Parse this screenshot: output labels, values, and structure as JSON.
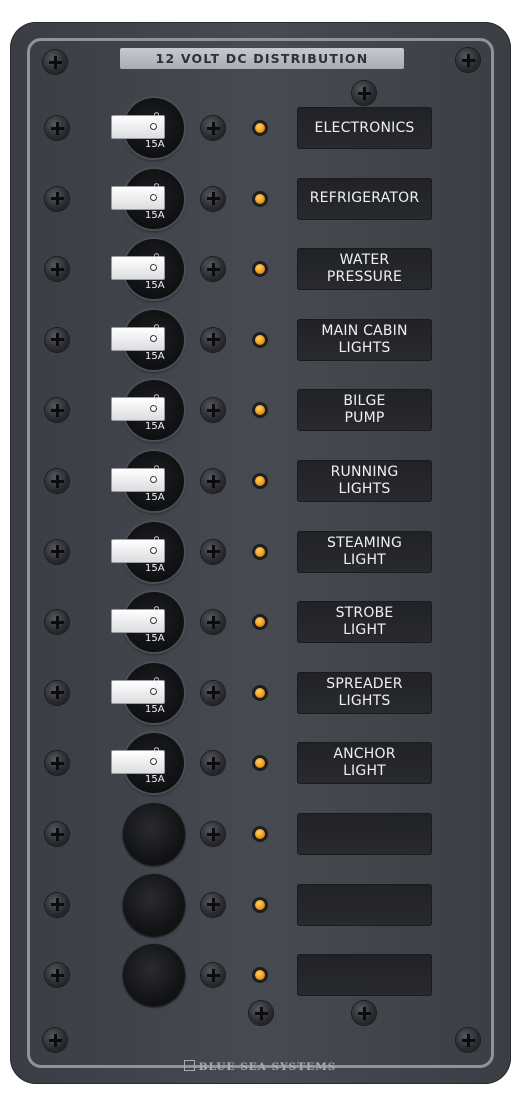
{
  "panel": {
    "title": "12 VOLT DC DISTRIBUTION",
    "brand": "BLUE SEA SYSTEMS"
  },
  "circuits": [
    {
      "label": "ELECTRONICS",
      "amps": "15A",
      "state": "OFF",
      "populated": true
    },
    {
      "label": "REFRIGERATOR",
      "amps": "15A",
      "state": "OFF",
      "populated": true
    },
    {
      "label": "WATER\nPRESSURE",
      "amps": "15A",
      "state": "OFF",
      "populated": true
    },
    {
      "label": "MAIN CABIN\nLIGHTS",
      "amps": "15A",
      "state": "OFF",
      "populated": true
    },
    {
      "label": "BILGE\nPUMP",
      "amps": "15A",
      "state": "OFF",
      "populated": true
    },
    {
      "label": "RUNNING\nLIGHTS",
      "amps": "15A",
      "state": "OFF",
      "populated": true
    },
    {
      "label": "STEAMING\nLIGHT",
      "amps": "15A",
      "state": "OFF",
      "populated": true
    },
    {
      "label": "STROBE\nLIGHT",
      "amps": "15A",
      "state": "OFF",
      "populated": true
    },
    {
      "label": "SPREADER\nLIGHTS",
      "amps": "15A",
      "state": "OFF",
      "populated": true
    },
    {
      "label": "ANCHOR\nLIGHT",
      "amps": "15A",
      "state": "OFF",
      "populated": true
    },
    {
      "label": "",
      "amps": "",
      "state": "",
      "populated": false
    },
    {
      "label": "",
      "amps": "",
      "state": "",
      "populated": false
    },
    {
      "label": "",
      "amps": "",
      "state": "",
      "populated": false
    }
  ],
  "colors": {
    "panel": "#43464c",
    "led": "#f4a020",
    "label_plate": "#242528",
    "title_plate": "#b8bbc0"
  }
}
